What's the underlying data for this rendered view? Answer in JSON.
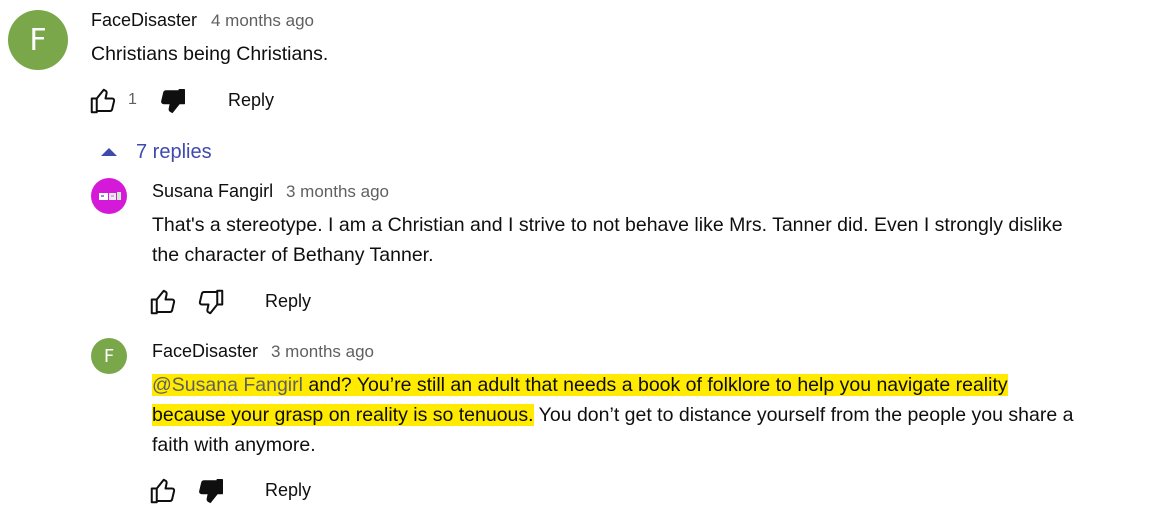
{
  "colors": {
    "avatar_face_disaster": "#7aa74a",
    "avatar_susana": "#d41ad8",
    "replies_link": "#3e4aad",
    "highlight": "#ffea00"
  },
  "icons": {
    "like": "thumbs-up-outline-icon",
    "dislike_filled": "thumbs-down-filled-icon",
    "dislike_outline": "thumbs-down-outline-icon",
    "collapse": "caret-up-icon"
  },
  "top_comment": {
    "avatar_letter": "F",
    "author": "FaceDisaster",
    "time": "4 months ago",
    "text": "Christians being Christians.",
    "like_count": "1",
    "reply_label": "Reply"
  },
  "replies_toggle": {
    "label": "7 replies"
  },
  "replies": [
    {
      "author": "Susana Fangirl",
      "time": "3 months ago",
      "text": "That's a stereotype. I am a Christian and I strive to not behave like Mrs. Tanner did. Even I strongly dislike the  character of Bethany Tanner.",
      "reply_label": "Reply"
    },
    {
      "avatar_letter": "F",
      "author": "FaceDisaster",
      "time": "3 months ago",
      "mention": "@Susana Fangirl",
      "text_highlighted_1": "  and? You’re still an adult that needs a book of folklore to help you navigate reality",
      "text_highlighted_2": "because your grasp on reality is so tenuous.",
      "text_rest": " You don’t get to distance yourself from the people you share a faith with anymore.",
      "reply_label": "Reply"
    }
  ]
}
